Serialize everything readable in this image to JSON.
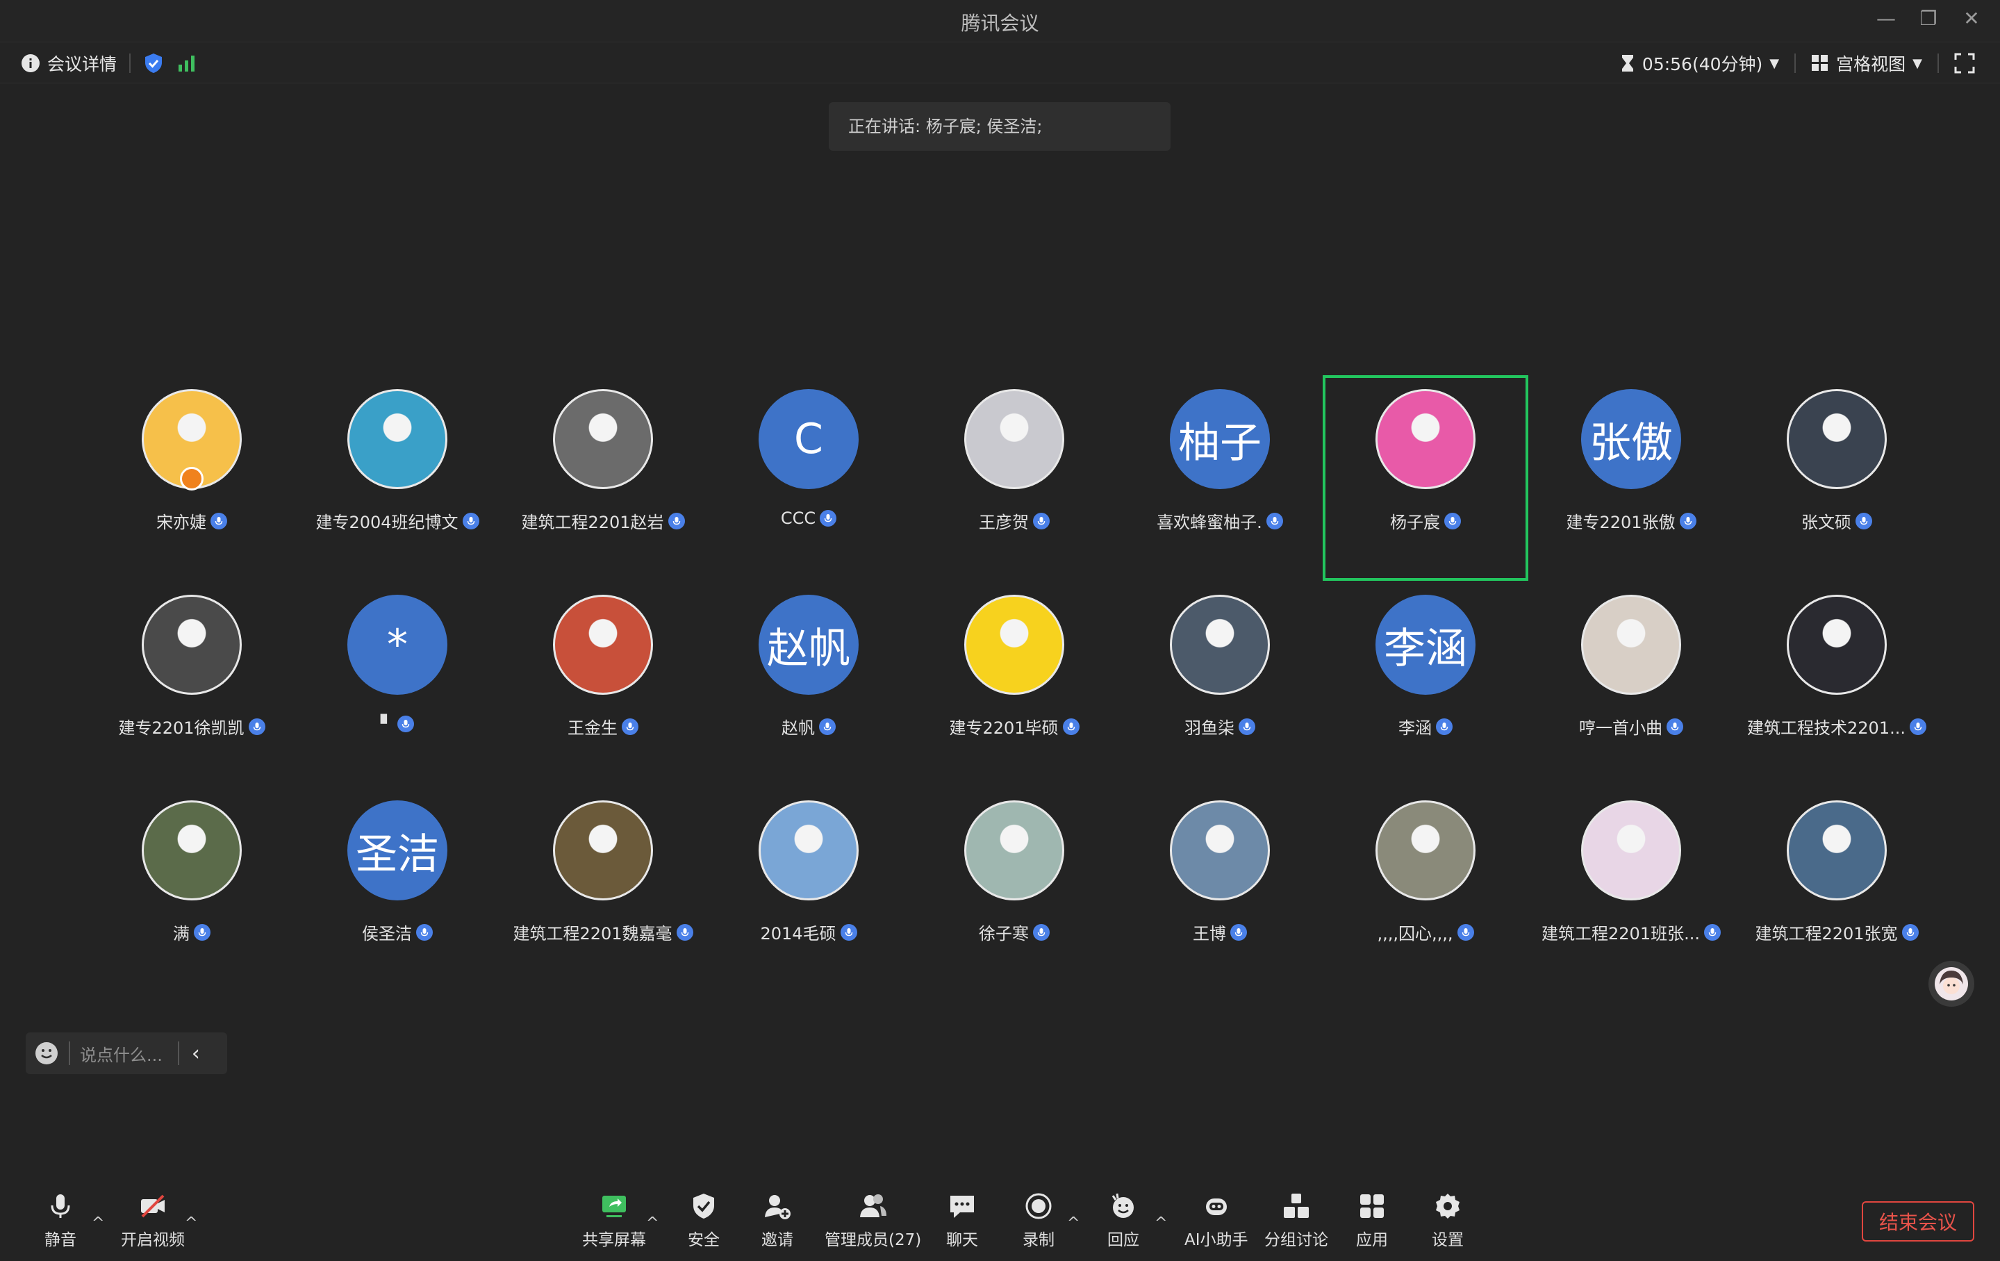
{
  "window": {
    "title": "腾讯会议",
    "minimize": "—",
    "restore": "❐",
    "close": "✕"
  },
  "infobar": {
    "meeting_details": "会议详情",
    "timer": "05:56(40分钟)",
    "view_mode": "宫格视图"
  },
  "speaking": "正在讲话: 杨子宸; 侯圣洁;",
  "participants": [
    {
      "name": "宋亦婕",
      "avatar_type": "image",
      "avatar_color": "#f6c04a",
      "host": true
    },
    {
      "name": "建专2004班纪博文",
      "avatar_type": "image",
      "avatar_color": "#3aa0c8"
    },
    {
      "name": "建筑工程2201赵岩",
      "avatar_type": "image",
      "avatar_color": "#6b6b6b"
    },
    {
      "name": "CCC",
      "avatar_type": "text",
      "avatar_text": "C"
    },
    {
      "name": "王彦贺",
      "avatar_type": "image",
      "avatar_color": "#c9c9cf"
    },
    {
      "name": "喜欢蜂蜜柚子.",
      "avatar_type": "text",
      "avatar_text": "柚子"
    },
    {
      "name": "杨子宸",
      "avatar_type": "image",
      "avatar_color": "#e85aa8",
      "active": true
    },
    {
      "name": "建专2201张傲",
      "avatar_type": "text",
      "avatar_text": "张傲"
    },
    {
      "name": "张文硕",
      "avatar_type": "image",
      "avatar_color": "#3a4350"
    },
    {
      "name": "建专2201徐凯凯",
      "avatar_type": "image",
      "avatar_color": "#4a4a4a"
    },
    {
      "name": "▘",
      "avatar_type": "text",
      "avatar_text": "*"
    },
    {
      "name": "王金生",
      "avatar_type": "image",
      "avatar_color": "#c8503a"
    },
    {
      "name": "赵帆",
      "avatar_type": "text",
      "avatar_text": "赵帆"
    },
    {
      "name": "建专2201毕硕",
      "avatar_type": "image",
      "avatar_color": "#f7d21e"
    },
    {
      "name": "羽鱼柒",
      "avatar_type": "image",
      "avatar_color": "#4c5a6a"
    },
    {
      "name": "李涵",
      "avatar_type": "text",
      "avatar_text": "李涵"
    },
    {
      "name": "哼一首小曲",
      "avatar_type": "image",
      "avatar_color": "#d8cfc6"
    },
    {
      "name": "建筑工程技术2201...",
      "avatar_type": "image",
      "avatar_color": "#2a2a30"
    },
    {
      "name": "满",
      "avatar_type": "image",
      "avatar_color": "#5b6b4a"
    },
    {
      "name": "侯圣洁",
      "avatar_type": "text",
      "avatar_text": "圣洁"
    },
    {
      "name": "建筑工程2201魏嘉毫",
      "avatar_type": "image",
      "avatar_color": "#6b5a3a"
    },
    {
      "name": "2014毛硕",
      "avatar_type": "image",
      "avatar_color": "#7aa6d6"
    },
    {
      "name": "徐子寒",
      "avatar_type": "image",
      "avatar_color": "#9fb7b0"
    },
    {
      "name": "王博",
      "avatar_type": "image",
      "avatar_color": "#6d8aa8"
    },
    {
      "name": ",,,,囚心,,,,",
      "avatar_type": "image",
      "avatar_color": "#8a8a7a"
    },
    {
      "name": "建筑工程2201班张...",
      "avatar_type": "image",
      "avatar_color": "#e8d6e6"
    },
    {
      "name": "建筑工程2201张宽",
      "avatar_type": "image",
      "avatar_color": "#4a6a8a"
    }
  ],
  "chat": {
    "placeholder": "说点什么..."
  },
  "toolbar": {
    "mute": "静音",
    "video": "开启视频",
    "share": "共享屏幕",
    "security": "安全",
    "invite": "邀请",
    "members": "管理成员(27)",
    "chat": "聊天",
    "record": "录制",
    "react": "回应",
    "ai": "AI小助手",
    "breakout": "分组讨论",
    "apps": "应用",
    "settings": "设置",
    "end": "结束会议"
  },
  "colors": {
    "accent_blue": "#3e73c8",
    "active_border": "#22c55e",
    "end_red": "#e0463f"
  }
}
